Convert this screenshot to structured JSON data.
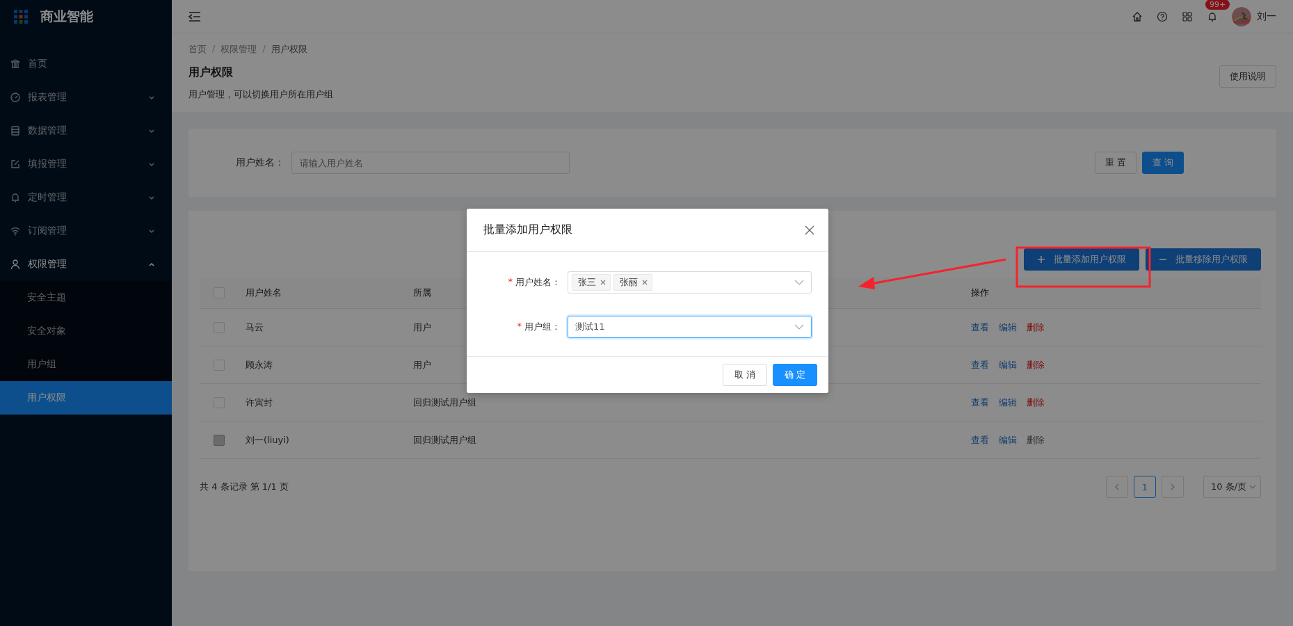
{
  "app": {
    "title": "商业智能"
  },
  "sidebar": {
    "items": [
      {
        "label": "首页"
      },
      {
        "label": "报表管理",
        "expanded": false
      },
      {
        "label": "数据管理",
        "expanded": false
      },
      {
        "label": "填报管理",
        "expanded": false
      },
      {
        "label": "定时管理",
        "expanded": false
      },
      {
        "label": "订阅管理",
        "expanded": false
      },
      {
        "label": "权限管理",
        "expanded": true,
        "children": [
          {
            "label": "安全主题",
            "selected": false
          },
          {
            "label": "安全对象",
            "selected": false
          },
          {
            "label": "用户组",
            "selected": false
          },
          {
            "label": "用户权限",
            "selected": true
          }
        ]
      }
    ]
  },
  "header": {
    "notifications": "99+",
    "user": "刘一"
  },
  "page": {
    "breadcrumb": [
      "首页",
      "/",
      "权限管理",
      "/",
      "用户权限"
    ],
    "title": "用户权限",
    "description": "用户管理，可以切换用户所在用户组",
    "help_button": "使用说明"
  },
  "search": {
    "label": "用户姓名：",
    "placeholder": "请输入用户姓名",
    "buttons": [
      {
        "label": "重 置",
        "primary": false
      },
      {
        "label": "查 询",
        "primary": true
      }
    ]
  },
  "toolbar": {
    "buttons": [
      {
        "label": "批量添加用户权限",
        "kind": "add"
      },
      {
        "label": "批量移除用户权限",
        "kind": "remove"
      }
    ]
  },
  "table": {
    "select_all_checked": false,
    "columns": [
      "用户姓名",
      "所属",
      "操作"
    ],
    "rows": [
      {
        "checked": false,
        "disabled": false,
        "name": "马云",
        "group": "用户",
        "actions": [
          {
            "label": "查看",
            "kind": "view",
            "disabled": false
          },
          {
            "label": "编辑",
            "kind": "edit",
            "disabled": false
          },
          {
            "label": "删除",
            "kind": "delete",
            "disabled": false
          }
        ]
      },
      {
        "checked": false,
        "disabled": false,
        "name": "顾永涛",
        "group": "用户",
        "actions": [
          {
            "label": "查看",
            "kind": "view",
            "disabled": false
          },
          {
            "label": "编辑",
            "kind": "edit",
            "disabled": false
          },
          {
            "label": "删除",
            "kind": "delete",
            "disabled": false
          }
        ]
      },
      {
        "checked": false,
        "disabled": false,
        "name": "许寅封",
        "group": "回归测试用户组",
        "actions": [
          {
            "label": "查看",
            "kind": "view",
            "disabled": false
          },
          {
            "label": "编辑",
            "kind": "edit",
            "disabled": false
          },
          {
            "label": "删除",
            "kind": "delete",
            "disabled": false
          }
        ]
      },
      {
        "checked": false,
        "disabled": true,
        "name": "刘一(liuyi)",
        "group": "回归测试用户组",
        "actions": [
          {
            "label": "查看",
            "kind": "view",
            "disabled": false
          },
          {
            "label": "编辑",
            "kind": "edit",
            "disabled": false
          },
          {
            "label": "删除",
            "kind": "delete",
            "disabled": true
          }
        ]
      }
    ]
  },
  "pagination": {
    "summary": "共 4 条记录 第 1/1 页",
    "pages": [
      {
        "label": "1",
        "selected": true
      }
    ],
    "page_size": "10 条/页"
  },
  "modal": {
    "title": "批量添加用户权限",
    "fields": [
      {
        "label": "用户姓名：",
        "required_mark": "*",
        "kind": "tags",
        "tags": [
          "张三",
          "张丽"
        ],
        "focused": false
      },
      {
        "label": "用户组：",
        "required_mark": "*",
        "kind": "select",
        "value": "测试11",
        "focused": true
      }
    ],
    "buttons": [
      {
        "label": "取 消",
        "primary": false
      },
      {
        "label": "确 定",
        "primary": true
      }
    ]
  }
}
